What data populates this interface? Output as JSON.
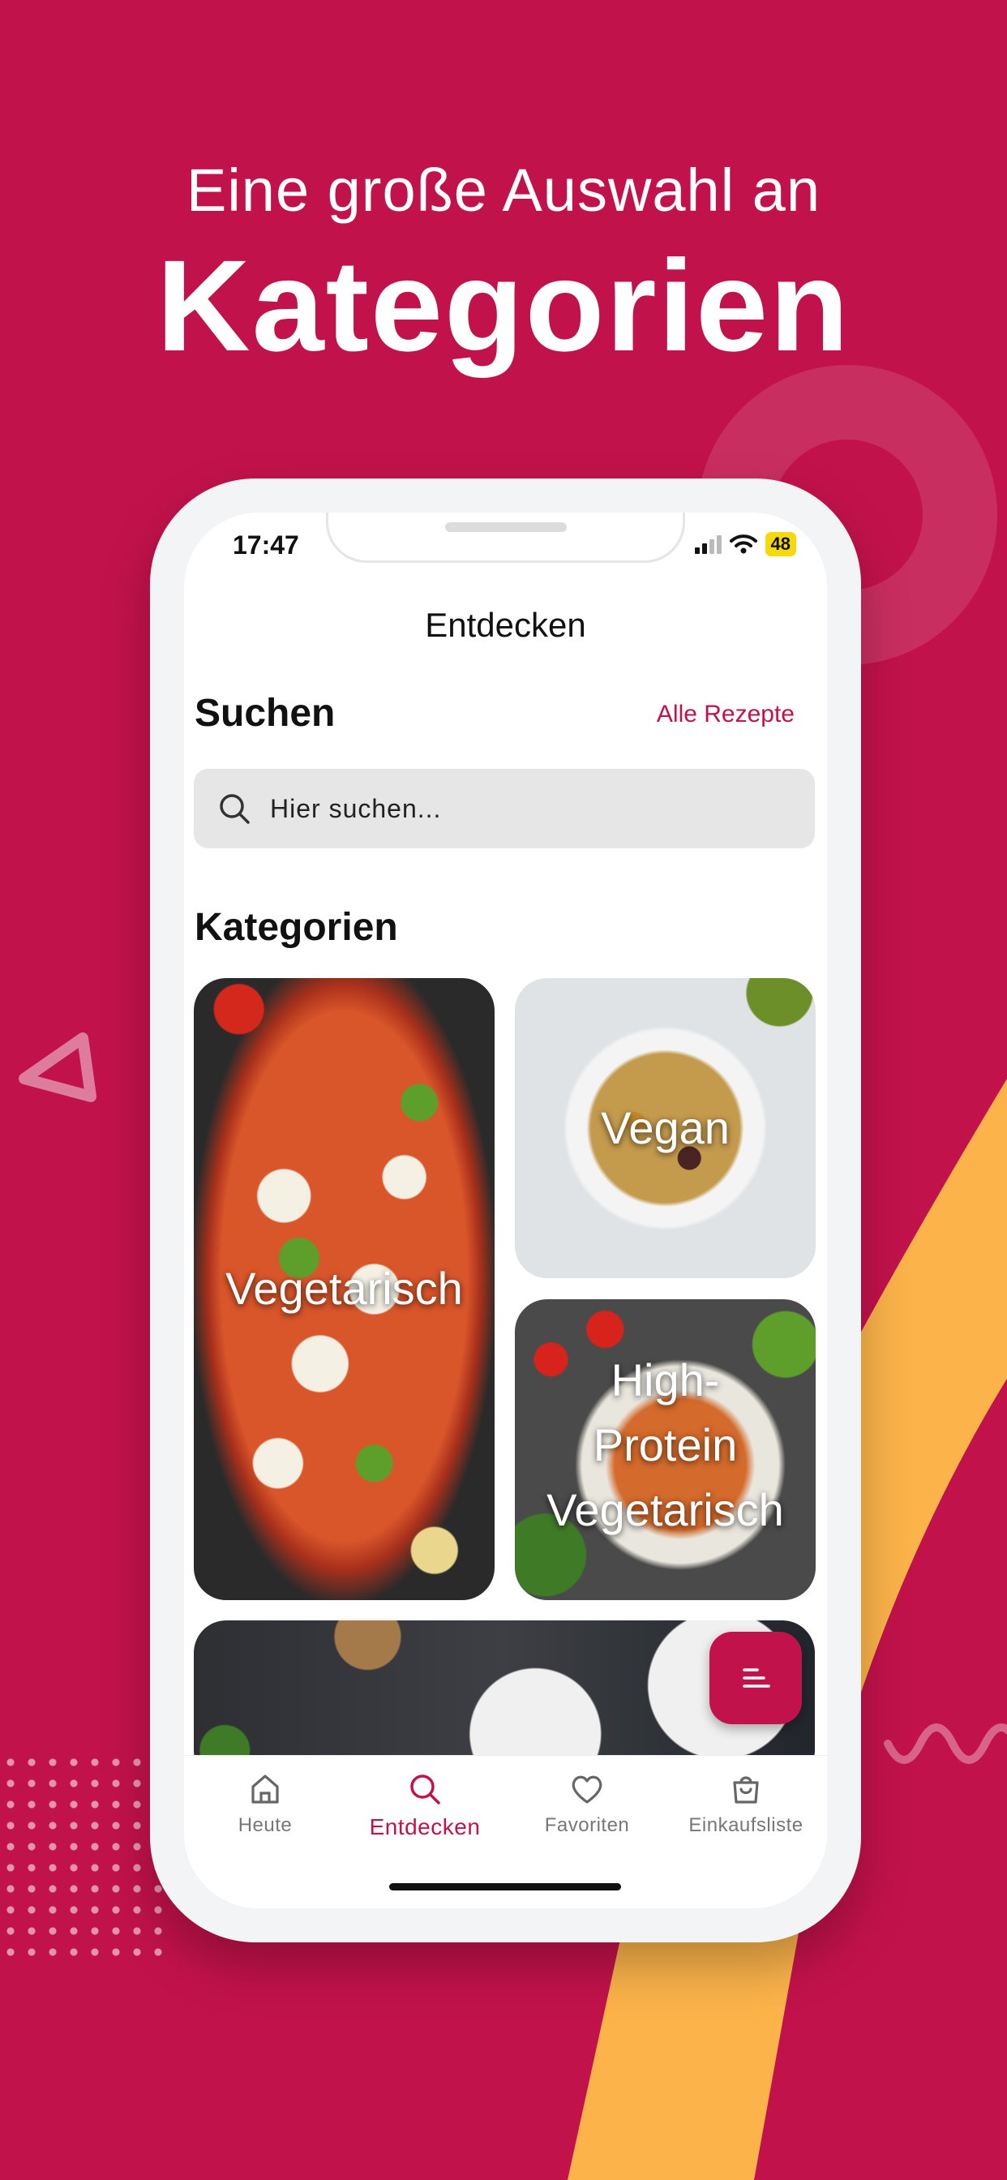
{
  "headline": {
    "line1": "Eine große Auswahl an",
    "line2": "Kategorien"
  },
  "status_bar": {
    "time": "17:47",
    "battery": "48"
  },
  "nav": {
    "title": "Entdecken"
  },
  "search_section": {
    "title": "Suchen",
    "all_recipes_link": "Alle Rezepte",
    "placeholder": "Hier suchen..."
  },
  "categories": {
    "title": "Kategorien",
    "items": [
      {
        "label": "Vegetarisch"
      },
      {
        "label": "Vegan"
      },
      {
        "label": "High-\nProtein\nVegetarisch"
      },
      {
        "label": ""
      }
    ]
  },
  "tabbar": {
    "tabs": [
      {
        "label": "Heute",
        "icon": "home-icon"
      },
      {
        "label": "Entdecken",
        "icon": "search-icon"
      },
      {
        "label": "Favoriten",
        "icon": "heart-icon"
      },
      {
        "label": "Einkaufsliste",
        "icon": "shopping-bag-icon"
      }
    ],
    "active_index": 1
  },
  "colors": {
    "brand": "#c2124b",
    "accent": "#fbb34a",
    "battery": "#f5d90a"
  }
}
